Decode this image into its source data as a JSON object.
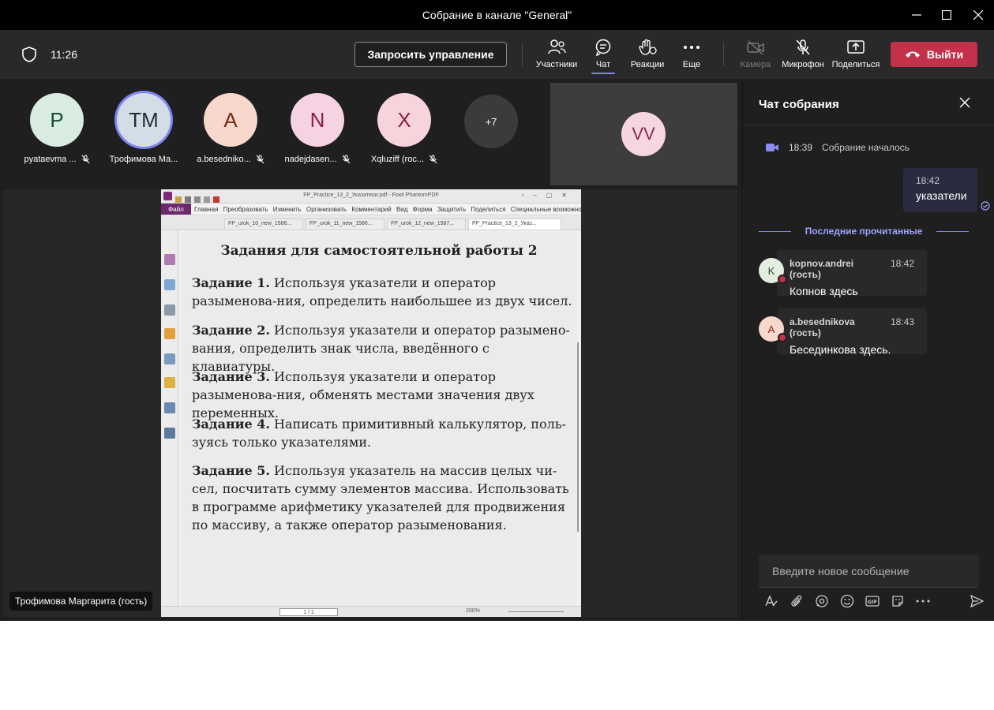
{
  "window": {
    "title": "Собрание в канале \"General\""
  },
  "toolbar": {
    "time": "11:26",
    "request_control": "Запросить управление",
    "participants": "Участники",
    "chat": "Чат",
    "reactions": "Реакции",
    "more": "Еще",
    "camera": "Камера",
    "mic": "Микрофон",
    "share": "Поделиться",
    "leave": "Выйти"
  },
  "participants": [
    {
      "initials": "P",
      "name": "pyataevma ...",
      "bg": "#d8ece1",
      "fg": "#1b4d33"
    },
    {
      "initials": "TM",
      "name": "Трофимова Ма...",
      "bg": "#d2dde6",
      "fg": "#1f2d3d",
      "active": true
    },
    {
      "initials": "A",
      "name": "a.besedniko...",
      "bg": "#f8d7cc",
      "fg": "#7a2a16"
    },
    {
      "initials": "N",
      "name": "nadejdasen...",
      "bg": "#f6d3e2",
      "fg": "#8a1f4b"
    },
    {
      "initials": "X",
      "name": "Xqluziff (гос...",
      "bg": "#f7d4dc",
      "fg": "#8d2036"
    }
  ],
  "more_participants": "+7",
  "video_tile": {
    "initials": "VV"
  },
  "stage": {
    "presenter_label": "Трофимова Маргарита (гость)"
  },
  "pdf": {
    "window_title": "FP_Practice_13_2_Указатели.pdf - Foxit PhantomPDF",
    "menu_file": "Файл",
    "menu_items": [
      "Главная",
      "Преобразовать",
      "Изменить",
      "Организовать",
      "Комментарий",
      "Вид",
      "Форма",
      "Защитить",
      "Поделиться",
      "Специальные возможност"
    ],
    "tabs": [
      "FP_urok_10_new_1586...",
      "FP_urok_11_new_1586...",
      "FP_urok_12_new_1587...",
      "FP_Practice_13_2_Указ..."
    ],
    "heading": "Задания для самостоятельной работы 2",
    "tasks": [
      {
        "label": "Задание 1.",
        "text": " Используя указатели и оператор разыменова-ния, определить наибольшее из двух чисел."
      },
      {
        "label": "Задание 2.",
        "text": " Используя указатели и оператор разымено-вания, определить знак числа, введённого с клавиатуры."
      },
      {
        "label": "Задание 3.",
        "text": " Используя указатели и оператор разыменова-ния, обменять местами значения двух переменных."
      },
      {
        "label": "Задание 4.",
        "text": " Написать примитивный калькулятор, поль-зуясь только указателями."
      },
      {
        "label": "Задание 5.",
        "text": " Используя указатель на массив целых чи-сел, посчитать сумму элементов массива. Использовать в программе арифметику указателей для продвижения по массиву, а также оператор разыменования."
      }
    ],
    "page_indicator": "1 / 1",
    "zoom": "200%"
  },
  "chat": {
    "title": "Чат собрания",
    "system": {
      "time": "18:39",
      "text": "Собрание началось"
    },
    "my_message": {
      "time": "18:42",
      "text": "указатели"
    },
    "last_read": "Последние прочитанные",
    "messages": [
      {
        "initial": "K",
        "author": "kopnov.andrei (гость)",
        "time": "18:42",
        "text": "Копнов здесь",
        "bg": "#e3ede0",
        "fg": "#2d4a2a"
      },
      {
        "initial": "A",
        "author": "a.besednikova (гость)",
        "time": "18:43",
        "text": "Бесединкова здесь.",
        "bg": "#f8d7cc",
        "fg": "#7a2a16"
      }
    ],
    "compose_placeholder": "Введите новое сообщение",
    "gif_label": "GIF"
  }
}
